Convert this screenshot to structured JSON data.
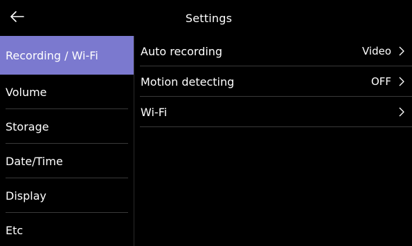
{
  "header": {
    "title": "Settings"
  },
  "sidebar": {
    "items": [
      {
        "label": "Recording / Wi-Fi"
      },
      {
        "label": "Volume"
      },
      {
        "label": "Storage"
      },
      {
        "label": "Date/Time"
      },
      {
        "label": "Display"
      },
      {
        "label": "Etc"
      }
    ],
    "active_color": "#7b79cf"
  },
  "settings": {
    "rows": [
      {
        "label": "Auto recording",
        "value": "Video"
      },
      {
        "label": "Motion detecting",
        "value": "OFF"
      },
      {
        "label": "Wi-Fi",
        "value": ""
      }
    ]
  }
}
